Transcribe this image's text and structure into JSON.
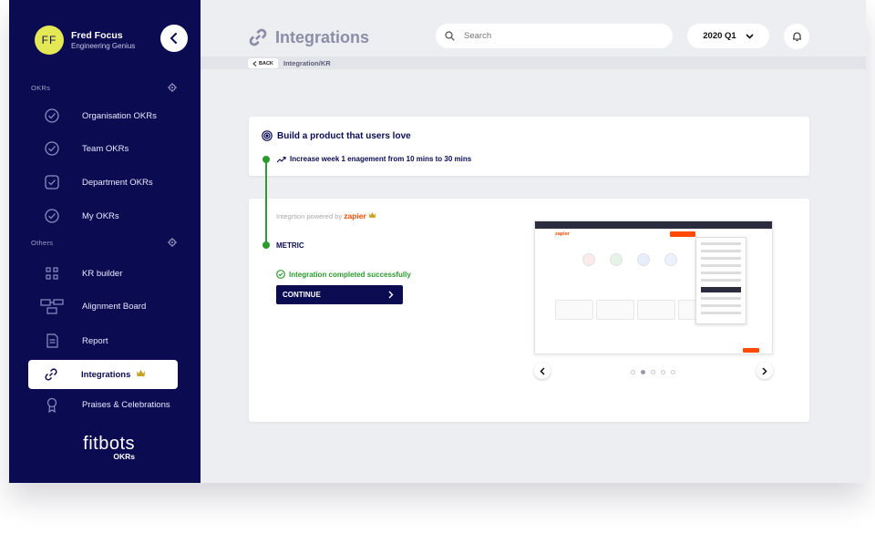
{
  "user": {
    "initials": "FF",
    "name": "Fred Focus",
    "role": "Engineering Genius"
  },
  "sidebar": {
    "section_okrs": "OKRs",
    "section_others": "Others",
    "items": [
      {
        "label": "Organisation OKRs",
        "icon": "check-circle-icon"
      },
      {
        "label": "Team OKRs",
        "icon": "check-circle-icon"
      },
      {
        "label": "Department OKRs",
        "icon": "check-square-icon"
      },
      {
        "label": "My OKRs",
        "icon": "check-circle-icon"
      },
      {
        "label": "KR builder",
        "icon": "grid-icon"
      },
      {
        "label": "Alignment Board",
        "icon": "hierarchy-icon"
      },
      {
        "label": "Report",
        "icon": "document-icon"
      },
      {
        "label": "Integrations",
        "icon": "link-icon",
        "active": true
      },
      {
        "label": "Praises & Celebrations",
        "icon": "medal-icon"
      }
    ],
    "logo_text": "fitbots",
    "logo_sub": "OKRs"
  },
  "header": {
    "title": "Integrations",
    "search_placeholder": "Search",
    "period": "2020 Q1",
    "back_label": "BACK",
    "breadcrumb": "Integration/KR"
  },
  "objective": {
    "title": "Build a product that users love",
    "key_result": "Increase week 1 enagement from 10 mins to 30 mins"
  },
  "integration": {
    "powered_text": "Integrtion powered by",
    "provider": "zapier",
    "metric_label": "METRIC",
    "success_text": "Integration completed successfully",
    "continue_label": "CONTINUE",
    "carousel_slides": 5,
    "carousel_active": 2
  },
  "colors": {
    "sidebar": "#0b0b52",
    "accent_green": "#2c9a2c",
    "zapier": "#ff4a00",
    "avatar": "#e4e854"
  }
}
